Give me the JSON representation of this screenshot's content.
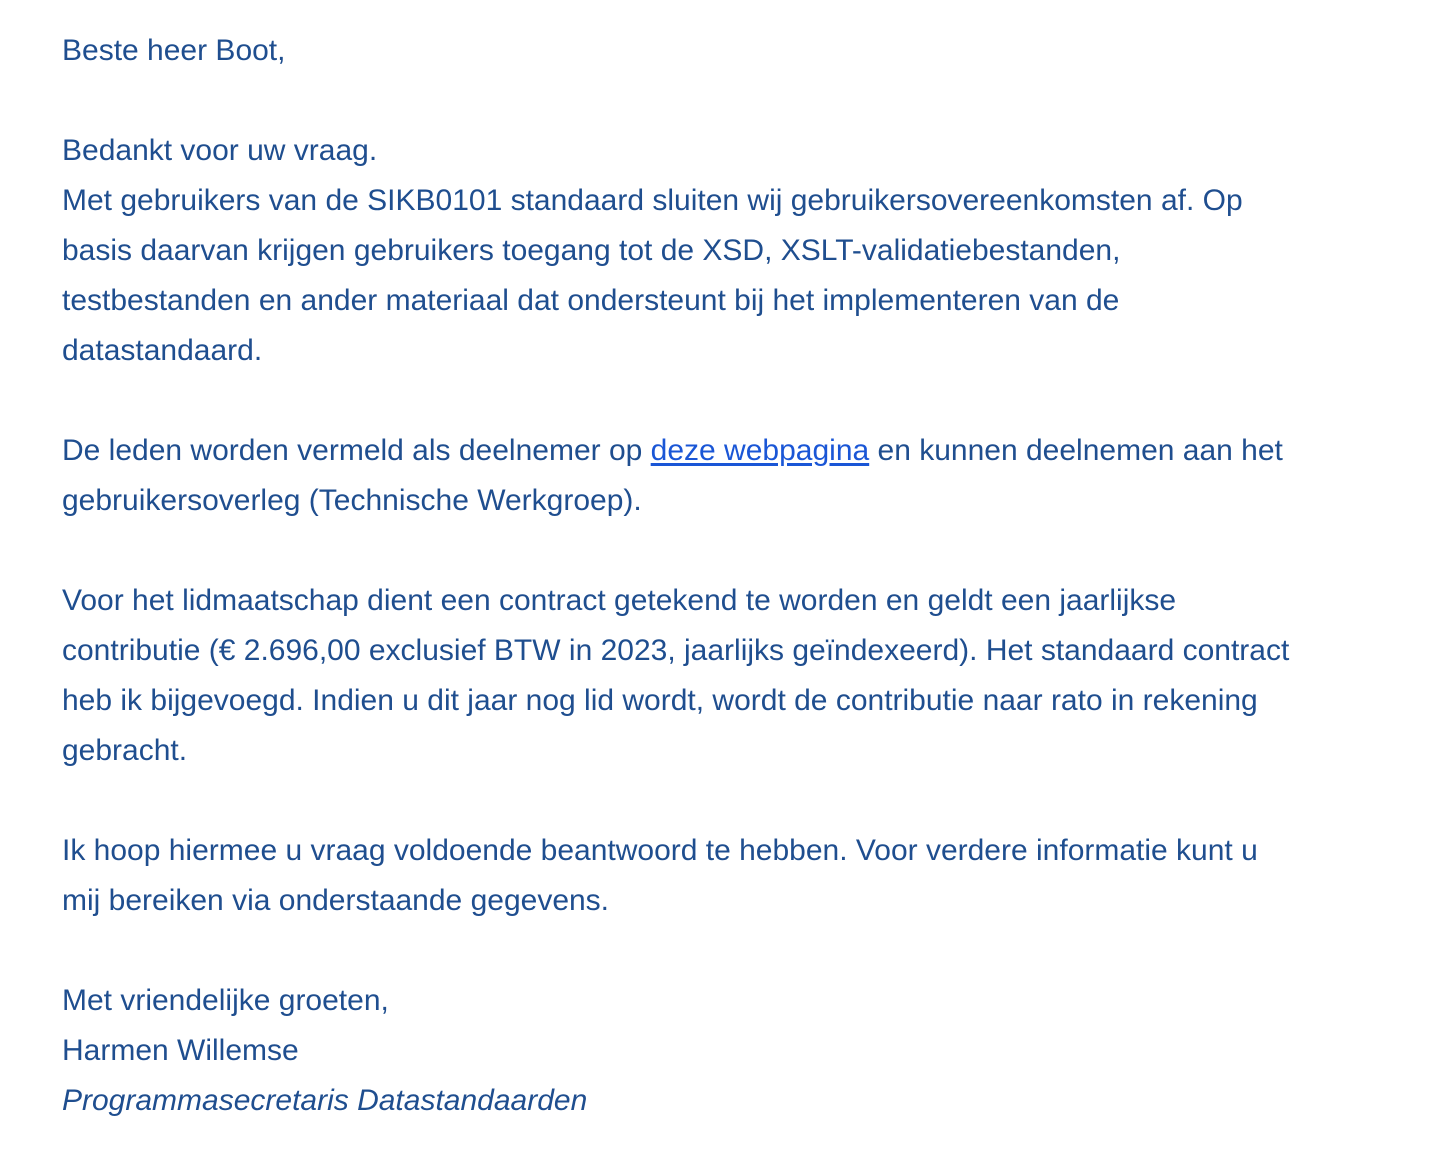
{
  "email": {
    "greeting": "Beste heer Boot,",
    "p1": {
      "line1": "Bedankt voor uw vraag.",
      "line2": "Met gebruikers van de SIKB0101 standaard sluiten wij gebruikersovereenkomsten af. Op",
      "line3": "basis daarvan krijgen gebruikers toegang tot de XSD, XSLT-validatiebestanden,",
      "line4": "testbestanden en ander materiaal dat ondersteunt bij het implementeren van de",
      "line5": "datastandaard."
    },
    "p2": {
      "line1_before": "De leden worden vermeld als deelnemer op ",
      "link_text": "deze webpagina",
      "line1_after": " en kunnen deelnemen aan het",
      "line2": "gebruikersoverleg (Technische Werkgroep)."
    },
    "p3": {
      "line1": "Voor het lidmaatschap dient een contract getekend te worden en geldt een jaarlijkse",
      "line2": "contributie (€ 2.696,00 exclusief BTW in 2023, jaarlijks geïndexeerd). Het standaard contract",
      "line3": "heb ik bijgevoegd. Indien u dit jaar nog lid wordt, wordt de contributie naar rato in rekening",
      "line4": "gebracht."
    },
    "p4": {
      "line1": "Ik hoop hiermee u vraag voldoende beantwoord te hebben. Voor verdere informatie kunt u",
      "line2": "mij bereiken via onderstaande gegevens."
    },
    "signature": {
      "closing": "Met vriendelijke groeten,",
      "name": "Harmen Willemse",
      "title": "Programmasecretaris Datastandaarden"
    }
  },
  "colors": {
    "text": "#1f4e8f",
    "link": "#1a56d6",
    "background": "#ffffff"
  }
}
